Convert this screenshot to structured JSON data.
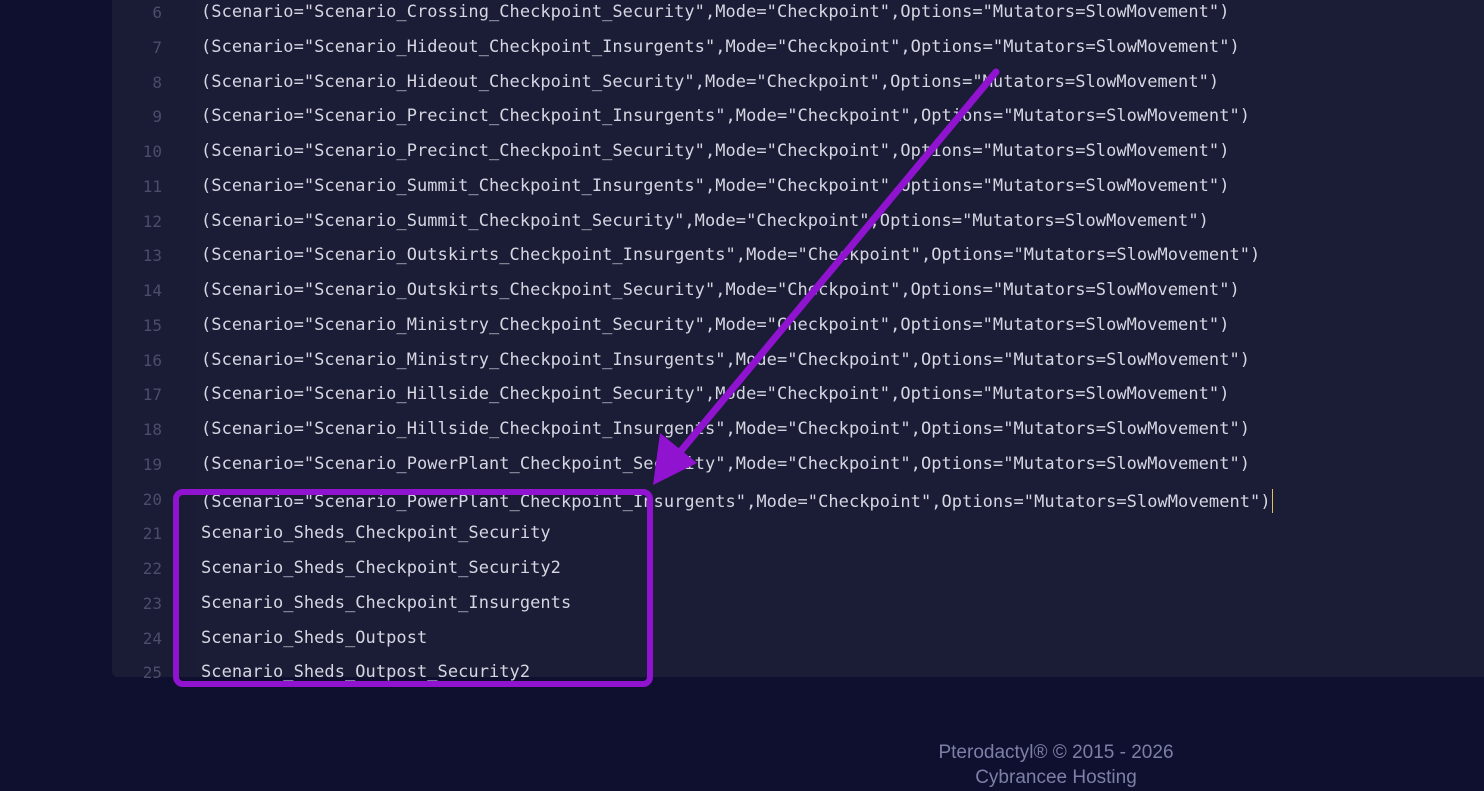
{
  "editor": {
    "lines": [
      {
        "num": "6",
        "text": "(Scenario=\"Scenario_Crossing_Checkpoint_Security\",Mode=\"Checkpoint\",Options=\"Mutators=SlowMovement\")"
      },
      {
        "num": "7",
        "text": "(Scenario=\"Scenario_Hideout_Checkpoint_Insurgents\",Mode=\"Checkpoint\",Options=\"Mutators=SlowMovement\")"
      },
      {
        "num": "8",
        "text": "(Scenario=\"Scenario_Hideout_Checkpoint_Security\",Mode=\"Checkpoint\",Options=\"Mutators=SlowMovement\")"
      },
      {
        "num": "9",
        "text": "(Scenario=\"Scenario_Precinct_Checkpoint_Insurgents\",Mode=\"Checkpoint\",Options=\"Mutators=SlowMovement\")"
      },
      {
        "num": "10",
        "text": "(Scenario=\"Scenario_Precinct_Checkpoint_Security\",Mode=\"Checkpoint\",Options=\"Mutators=SlowMovement\")"
      },
      {
        "num": "11",
        "text": "(Scenario=\"Scenario_Summit_Checkpoint_Insurgents\",Mode=\"Checkpoint\",Options=\"Mutators=SlowMovement\")"
      },
      {
        "num": "12",
        "text": "(Scenario=\"Scenario_Summit_Checkpoint_Security\",Mode=\"Checkpoint\",Options=\"Mutators=SlowMovement\")"
      },
      {
        "num": "13",
        "text": "(Scenario=\"Scenario_Outskirts_Checkpoint_Insurgents\",Mode=\"Checkpoint\",Options=\"Mutators=SlowMovement\")"
      },
      {
        "num": "14",
        "text": "(Scenario=\"Scenario_Outskirts_Checkpoint_Security\",Mode=\"Checkpoint\",Options=\"Mutators=SlowMovement\")"
      },
      {
        "num": "15",
        "text": "(Scenario=\"Scenario_Ministry_Checkpoint_Security\",Mode=\"Checkpoint\",Options=\"Mutators=SlowMovement\")"
      },
      {
        "num": "16",
        "text": "(Scenario=\"Scenario_Ministry_Checkpoint_Insurgents\",Mode=\"Checkpoint\",Options=\"Mutators=SlowMovement\")"
      },
      {
        "num": "17",
        "text": "(Scenario=\"Scenario_Hillside_Checkpoint_Security\",Mode=\"Checkpoint\",Options=\"Mutators=SlowMovement\")"
      },
      {
        "num": "18",
        "text": "(Scenario=\"Scenario_Hillside_Checkpoint_Insurgents\",Mode=\"Checkpoint\",Options=\"Mutators=SlowMovement\")"
      },
      {
        "num": "19",
        "text": "(Scenario=\"Scenario_PowerPlant_Checkpoint_Security\",Mode=\"Checkpoint\",Options=\"Mutators=SlowMovement\")"
      },
      {
        "num": "20",
        "text": "(Scenario=\"Scenario_PowerPlant_Checkpoint_Insurgents\",Mode=\"Checkpoint\",Options=\"Mutators=SlowMovement\")"
      },
      {
        "num": "21",
        "text": "Scenario_Sheds_Checkpoint_Security"
      },
      {
        "num": "22",
        "text": "Scenario_Sheds_Checkpoint_Security2"
      },
      {
        "num": "23",
        "text": "Scenario_Sheds_Checkpoint_Insurgents"
      },
      {
        "num": "24",
        "text": "Scenario_Sheds_Outpost"
      },
      {
        "num": "25",
        "text": "Scenario_Sheds_Outpost_Security2"
      }
    ]
  },
  "footer": {
    "line1": "Pterodactyl® © 2015 - 2026",
    "line2": "Cybrancee Hosting"
  },
  "annotation": {
    "color": "#8f13cf"
  }
}
